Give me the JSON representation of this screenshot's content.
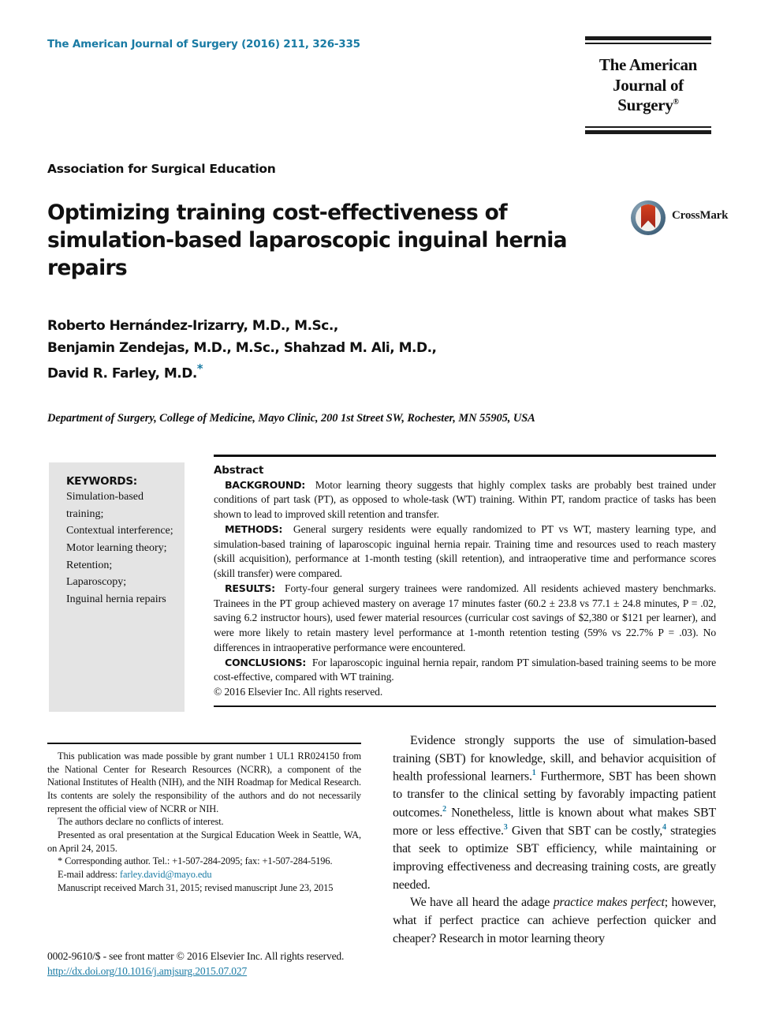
{
  "header": {
    "journal_citation": "The American Journal of Surgery (2016) 211, 326-335",
    "logo_line1": "The American",
    "logo_line2": "Journal of Surgery",
    "logo_registered": "®"
  },
  "article": {
    "society": "Association for Surgical Education",
    "title": "Optimizing training cost-effectiveness of simulation-based laparoscopic inguinal hernia repairs",
    "crossmark_label": "CrossMark",
    "authors": "Roberto Hernández-Irizarry, M.D., M.Sc., Benjamin Zendejas, M.D., M.Sc., Shahzad M. Ali, M.D., David R. Farley, M.D.",
    "author_line_1": "Roberto Hernández-Irizarry, M.D., M.Sc.,",
    "author_line_2": "Benjamin Zendejas, M.D., M.Sc., Shahzad M. Ali, M.D.,",
    "author_line_3": "David R. Farley, M.D.",
    "corresponding_marker": "*",
    "affiliation": "Department of Surgery, College of Medicine, Mayo Clinic, 200 1st Street SW, Rochester, MN 55905, USA"
  },
  "keywords": {
    "heading": "KEYWORDS:",
    "items": [
      "Simulation-based training;",
      "Contextual interference;",
      "Motor learning theory;",
      "Retention;",
      "Laparoscopy;",
      "Inguinal hernia repairs"
    ]
  },
  "abstract": {
    "heading": "Abstract",
    "sections": [
      {
        "label": "BACKGROUND:",
        "text": "Motor learning theory suggests that highly complex tasks are probably best trained under conditions of part task (PT), as opposed to whole-task (WT) training. Within PT, random practice of tasks has been shown to lead to improved skill retention and transfer."
      },
      {
        "label": "METHODS:",
        "text": "General surgery residents were equally randomized to PT vs WT, mastery learning type, and simulation-based training of laparoscopic inguinal hernia repair. Training time and resources used to reach mastery (skill acquisition), performance at 1-month testing (skill retention), and intraoperative time and performance scores (skill transfer) were compared."
      },
      {
        "label": "RESULTS:",
        "text": "Forty-four general surgery trainees were randomized. All residents achieved mastery benchmarks. Trainees in the PT group achieved mastery on average 17 minutes faster (60.2 ± 23.8 vs 77.1 ± 24.8 minutes, P = .02, saving 6.2 instructor hours), used fewer material resources (curricular cost savings of $2,380 or $121 per learner), and were more likely to retain mastery level performance at 1-month retention testing (59% vs 22.7% P = .03). No differences in intraoperative performance were encountered."
      },
      {
        "label": "CONCLUSIONS:",
        "text": "For laparoscopic inguinal hernia repair, random PT simulation-based training seems to be more cost-effective, compared with WT training."
      }
    ],
    "copyright": "© 2016 Elsevier Inc. All rights reserved."
  },
  "footnotes": {
    "grant": "This publication was made possible by grant number 1 UL1 RR024150 from the National Center for Research Resources (NCRR), a component of the National Institutes of Health (NIH), and the NIH Roadmap for Medical Research. Its contents are solely the responsibility of the authors and do not necessarily represent the official view of NCRR or NIH.",
    "conflicts": "The authors declare no conflicts of interest.",
    "presented": "Presented as oral presentation at the Surgical Education Week in Seattle, WA, on April 24, 2015.",
    "corresponding": "* Corresponding author. Tel.: +1-507-284-2095; fax: +1-507-284-5196.",
    "email_label": "E-mail address:",
    "email": "farley.david@mayo.edu",
    "manuscript": "Manuscript received March 31, 2015; revised manuscript June 23, 2015"
  },
  "body": {
    "paragraph_1_a": "Evidence strongly supports the use of simulation-based training (SBT) for knowledge, skill, and behavior acquisition of health professional learners.",
    "ref_1": "1",
    "paragraph_1_b": " Furthermore, SBT has been shown to transfer to the clinical setting by favorably impacting patient outcomes.",
    "ref_2": "2",
    "paragraph_1_c": " Nonetheless, little is known about what makes SBT more or less effective.",
    "ref_3": "3",
    "paragraph_1_d": " Given that SBT can be costly,",
    "ref_4": "4",
    "paragraph_1_e": " strategies that seek to optimize SBT efficiency, while maintaining or improving effectiveness and decreasing training costs, are greatly needed.",
    "paragraph_2_a": "We have all heard the adage ",
    "paragraph_2_italic": "practice makes perfect",
    "paragraph_2_b": "; however, what if perfect practice can achieve perfection quicker and cheaper? Research in motor learning theory"
  },
  "page_footer": {
    "issn_line": "0002-9610/$ - see front matter © 2016 Elsevier Inc. All rights reserved.",
    "doi": "http://dx.doi.org/10.1016/j.amjsurg.2015.07.027"
  },
  "colors": {
    "link_blue": "#1a7ba4",
    "keyword_box_gray": "#e4e4e4",
    "rule_black": "#111111",
    "crossmark_red": "#b8301a"
  }
}
